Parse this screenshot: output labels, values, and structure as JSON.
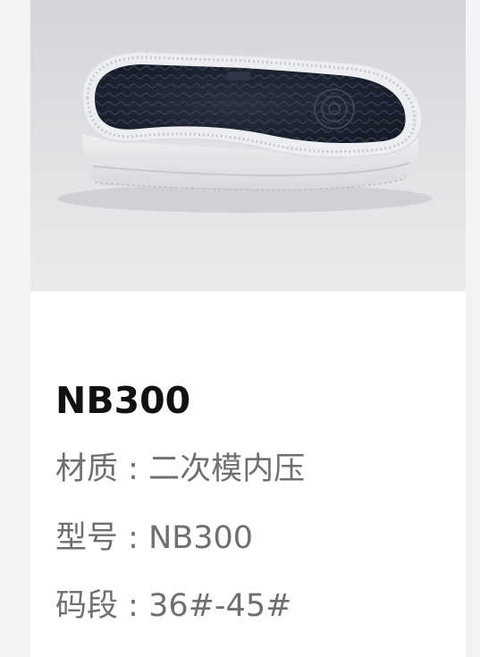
{
  "product": {
    "title": "NB300",
    "specs": [
      {
        "label": "材质",
        "sep": " : ",
        "value": "二次模内压"
      },
      {
        "label": "型号",
        "sep": " : ",
        "value": "NB300"
      },
      {
        "label": "码段",
        "sep": " : ",
        "value": "36#-45#"
      }
    ]
  },
  "colors": {
    "page_bg": "#f3f3f3",
    "card_bg": "#ffffff",
    "title_color": "#111111",
    "spec_color": "#6f6f6f",
    "sole_outsole": "#1e2433",
    "sole_rim": "#e9eaee"
  },
  "image": {
    "subject": "shoe-sole-photo"
  }
}
